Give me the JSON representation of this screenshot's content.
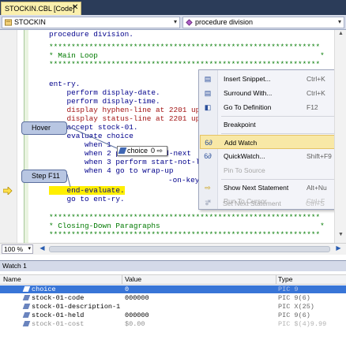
{
  "tab": {
    "title": "STOCKIN.CBL [Code]",
    "close_glyph": "✕"
  },
  "nav": {
    "left_combo": "STOCKIN",
    "right_combo": "procedure division",
    "arrow_glyph": "▾"
  },
  "code_lines": [
    "procedure division.",
    "*************************************************************",
    "* Main Loop                                                  *",
    "*************************************************************",
    "ent-ry.",
    "    perform display-date.",
    "    perform display-time.",
    "    display hyphen-line at 2201 upon",
    "    display status-line at 2201 upon",
    "    accept stock-01.",
    "    evaluate choice",
    "        when 1",
    "        when 2 perform read-next",
    "        when 3 perform start-not-less-than",
    "        when 4 go to wrap-up",
    "    end-evaluate.",
    "    go to ent-ry.",
    "*************************************************************",
    "* Closing-Down Paragraphs                                    *",
    "*************************************************************"
  ],
  "datatip": {
    "name": "choice",
    "value": "0",
    "pin_glyph": "⇨",
    "trailing_text": "-on-key"
  },
  "callouts": {
    "hover": "Hover",
    "step": "Step F11"
  },
  "context_menu": {
    "items": [
      {
        "label": "Insert Snippet...",
        "shortcut": "Ctrl+K",
        "icon": "snippet-icon",
        "glyph": "▤"
      },
      {
        "label": "Surround With...",
        "shortcut": "Ctrl+K",
        "icon": "surround-icon",
        "glyph": "▤"
      },
      {
        "label": "Go To Definition",
        "shortcut": "F12",
        "icon": "definition-icon",
        "glyph": "◧"
      },
      {
        "label": "Breakpoint",
        "shortcut": "",
        "icon": "",
        "glyph": ""
      },
      {
        "label": "Add Watch",
        "shortcut": "",
        "icon": "watch-icon",
        "glyph": "6∂"
      },
      {
        "label": "QuickWatch...",
        "shortcut": "Shift+F9",
        "icon": "quickwatch-icon",
        "glyph": "6∂"
      },
      {
        "label": "Pin To Source",
        "shortcut": "",
        "icon": "",
        "glyph": ""
      },
      {
        "label": "Show Next Statement",
        "shortcut": "Alt+Nu",
        "icon": "next-statement-icon",
        "glyph": "⇨"
      },
      {
        "label": "Run To Cursor",
        "shortcut": "Ctrl+F",
        "icon": "run-cursor-icon",
        "glyph": "⇥"
      },
      {
        "label": "Set Next Statement",
        "shortcut": "Ctrl+S",
        "icon": "set-next-icon",
        "glyph": "●"
      }
    ]
  },
  "statusbar": {
    "zoom": "100 %",
    "left_arrow": "◀",
    "right_arrow": "▶"
  },
  "watch": {
    "title": "Watch 1",
    "columns": {
      "name": "Name",
      "value": "Value",
      "type": "Type"
    },
    "rows": [
      {
        "name": "choice",
        "value": "0",
        "type": "PIC 9"
      },
      {
        "name": "stock-01-code",
        "value": "000000",
        "type": "PIC 9(6)"
      },
      {
        "name": "stock-01-description-1",
        "value": "",
        "type": "PIC X(25)"
      },
      {
        "name": "stock-01-held",
        "value": "000000",
        "type": "PIC 9(6)"
      },
      {
        "name": "stock-01-cost",
        "value": "$0.00",
        "type": "PIC $(4)9.99"
      }
    ]
  },
  "colors": {
    "tab_strip": "#2b3c59",
    "tab_active": "#fbf0ad",
    "highlight": "#ffef00",
    "keyword": "#00008b",
    "comment": "#007a00",
    "selection": "#3875d7"
  }
}
